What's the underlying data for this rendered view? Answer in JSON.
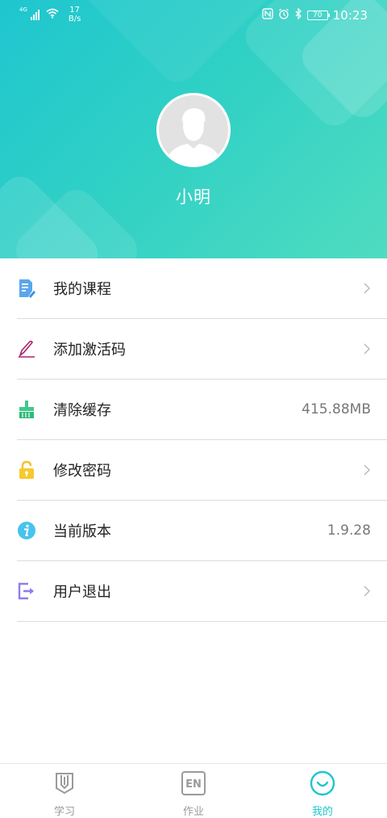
{
  "status_bar": {
    "network_type": "4G",
    "speed_value": "17",
    "speed_unit": "B/s",
    "battery": "70",
    "time": "10:23",
    "icons": [
      "nfc-icon",
      "alarm-icon",
      "bluetooth-icon"
    ]
  },
  "profile": {
    "username": "小明"
  },
  "menu": {
    "items": [
      {
        "label": "我的课程",
        "icon": "course-document-icon",
        "right_text": ""
      },
      {
        "label": "添加激活码",
        "icon": "pen-icon",
        "right_text": ""
      },
      {
        "label": "清除缓存",
        "icon": "broom-icon",
        "right_text": "415.88MB"
      },
      {
        "label": "修改密码",
        "icon": "lock-icon",
        "right_text": ""
      },
      {
        "label": "当前版本",
        "icon": "info-icon",
        "right_text": "1.9.28"
      },
      {
        "label": "用户退出",
        "icon": "logout-icon",
        "right_text": ""
      }
    ]
  },
  "tabbar": {
    "tabs": [
      {
        "label": "学习",
        "icon": "pencil-book-icon",
        "active": false
      },
      {
        "label": "作业",
        "icon": "en-icon",
        "en_text": "EN",
        "active": false
      },
      {
        "label": "我的",
        "icon": "smile-icon",
        "active": true
      }
    ]
  },
  "colors": {
    "accent": "#1ec6cf",
    "header_gradient_start": "#1fc6cf",
    "header_gradient_end": "#4fdcc0",
    "divider": "#dcdcdc",
    "inactive_tab": "#9a9a9a"
  }
}
